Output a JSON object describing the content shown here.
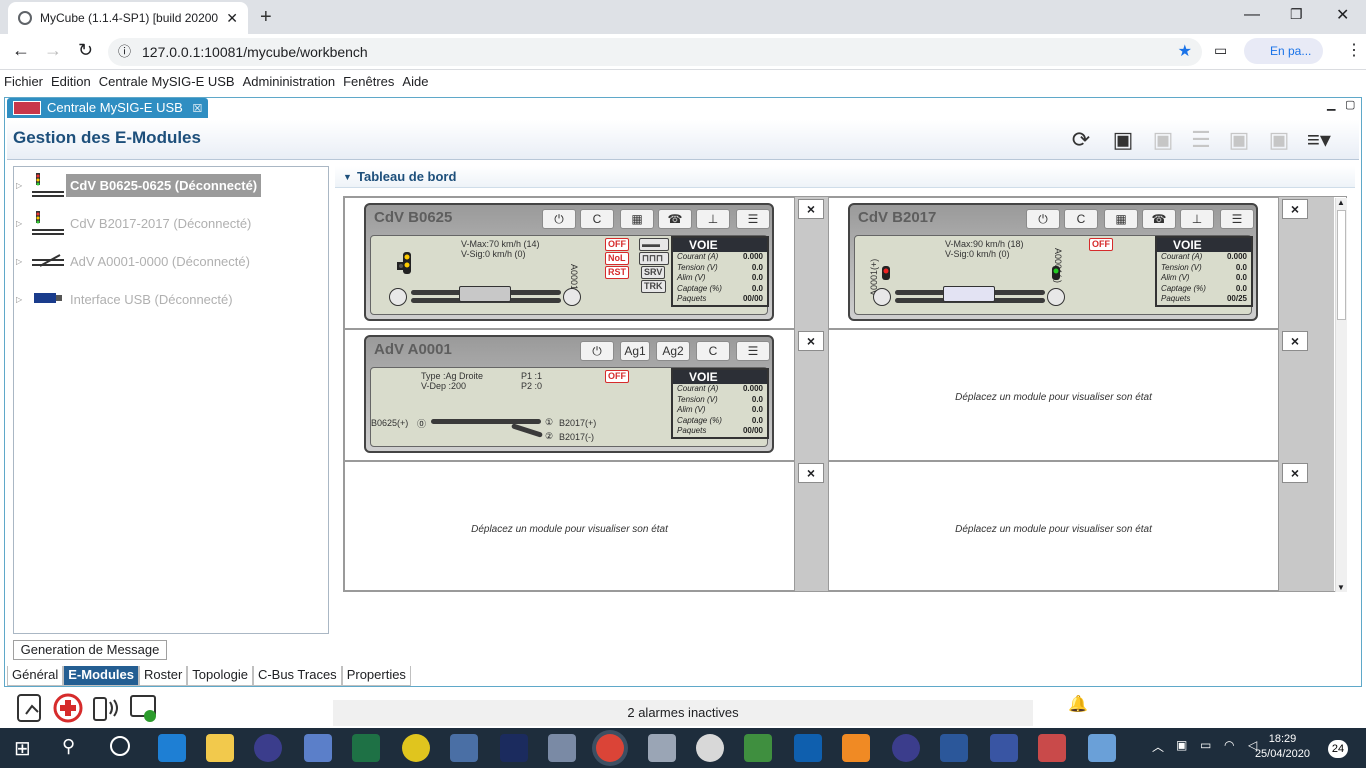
{
  "browser": {
    "tab_title": "MyCube (1.1.4-SP1) [build 20200",
    "url": "127.0.0.1:10081/mycube/workbench",
    "profile_label": "En pa..."
  },
  "menu": [
    "Fichier",
    "Edition",
    "Centrale MySIG-E USB",
    "Admininistration",
    "Fenêtres",
    "Aide"
  ],
  "app": {
    "tab_label": "Centrale MySIG-E USB",
    "header_title": "Gestion des E-Modules",
    "tree": [
      {
        "label": "CdV B0625-0625 (Déconnecté)"
      },
      {
        "label": "CdV B2017-2017 (Déconnecté)"
      },
      {
        "label": "AdV A0001-0000 (Déconnecté)"
      },
      {
        "label": "Interface USB (Déconnecté)"
      }
    ],
    "gen_message": "Generation de Message",
    "bottom_tabs": [
      "Général",
      "E-Modules",
      "Roster",
      "Topologie",
      "C-Bus Traces",
      "Properties"
    ],
    "dashboard_title": "Tableau de bord",
    "empty_text": "Déplacez un module pour visualiser son état",
    "close_label": "×"
  },
  "modules": {
    "cdv1": {
      "title": "CdV B0625",
      "btn_c": "C",
      "vmax": "V-Max:70 km/h (14)",
      "vsig": "V-Sig:0 km/h (0)",
      "badge_off": "OFF",
      "badge_nol": "NoL",
      "badge_rst": "RST",
      "badge_srv": "SRV",
      "badge_trk": "TRK",
      "side_label": "A0001(+)",
      "voie": {
        "title": "VOIE",
        "courant": "0.000",
        "tension": "0.0",
        "alim": "0.0",
        "captage": "0.0",
        "paquets": "00/00"
      }
    },
    "cdv2": {
      "title": "CdV B2017",
      "btn_c": "C",
      "vmax": "V-Max:90 km/h (18)",
      "vsig": "V-Sig:0 km/h (0)",
      "badge_off": "OFF",
      "side_left": "A0001(+)",
      "side_right": "A0001(-)",
      "voie": {
        "title": "VOIE",
        "courant": "0.000",
        "tension": "0.0",
        "alim": "0.0",
        "captage": "0.0",
        "paquets": "00/25"
      }
    },
    "adv": {
      "title": "AdV A0001",
      "btn_ag1": "Ag1",
      "btn_ag2": "Ag2",
      "btn_c": "C",
      "type": "Type :Ag Droite",
      "vdep": "V-Dep :200",
      "p1": "P1 :1",
      "p2": "P2 :0",
      "badge_off": "OFF",
      "left": "B0625(+)",
      "out1": "B2017(+)",
      "out2": "B2017(-)",
      "voie": {
        "title": "VOIE",
        "courant": "0.000",
        "tension": "0.0",
        "alim": "0.0",
        "captage": "0.0",
        "paquets": "00/00"
      }
    },
    "voie_labels": {
      "courant": "Courant (A)",
      "tension": "Tension (V)",
      "alim": "Alim (V)",
      "captage": "Captage (%)",
      "paquets": "Paquets"
    }
  },
  "status": {
    "alarms": "2 alarmes inactives"
  },
  "taskbar": {
    "time": "18:29",
    "date": "25/04/2020",
    "notif": "24"
  }
}
